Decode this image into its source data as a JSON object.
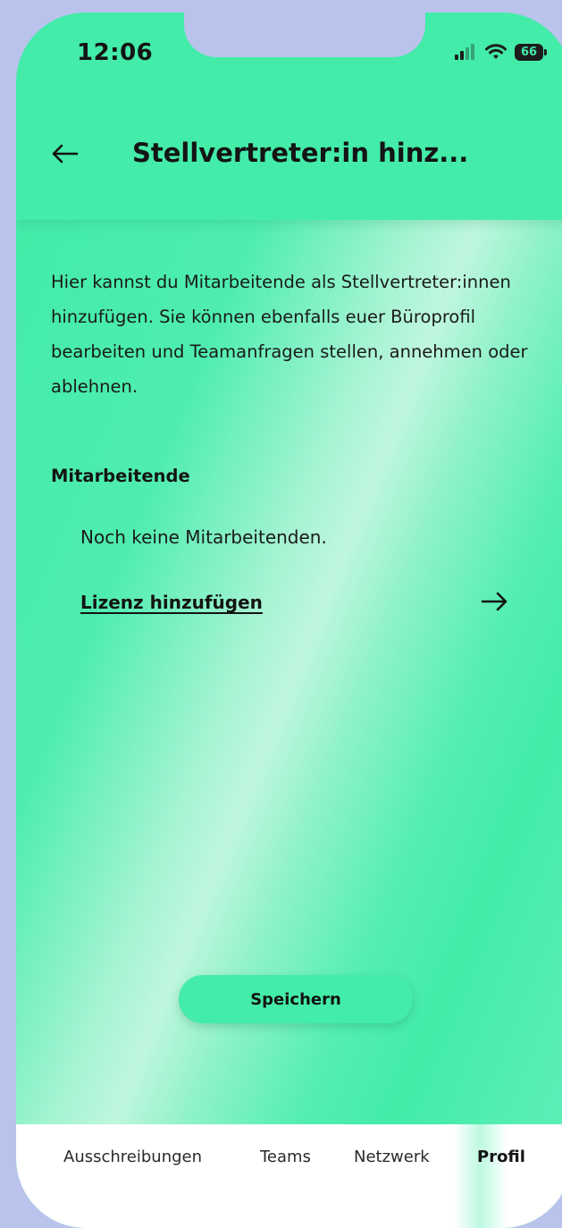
{
  "status_bar": {
    "time": "12:06",
    "battery": "66"
  },
  "header": {
    "title": "Stellvertreter:in hinz...",
    "back_icon": "arrow-left-icon"
  },
  "content": {
    "intro": "Hier kannst du Mitarbeitende als Stellvertreter:innen hinzufügen. Sie können ebenfalls euer Büroprofil bearbeiten und Teamanfragen stellen, annehmen oder ablehnen.",
    "section_title": "Mitarbeitende",
    "empty_text": "Noch keine Mitarbeitenden.",
    "license_link": "Lizenz hinzufügen",
    "forward_icon": "arrow-right-icon",
    "save_button": "Speichern"
  },
  "tabbar": {
    "items": [
      {
        "label": "Ausschreibungen",
        "active": false
      },
      {
        "label": "Teams",
        "active": false
      },
      {
        "label": "Netzwerk",
        "active": false
      },
      {
        "label": "Profil",
        "active": true
      }
    ]
  },
  "colors": {
    "accent": "#43eca8",
    "background": "#b9c3ec",
    "text": "#141414"
  }
}
